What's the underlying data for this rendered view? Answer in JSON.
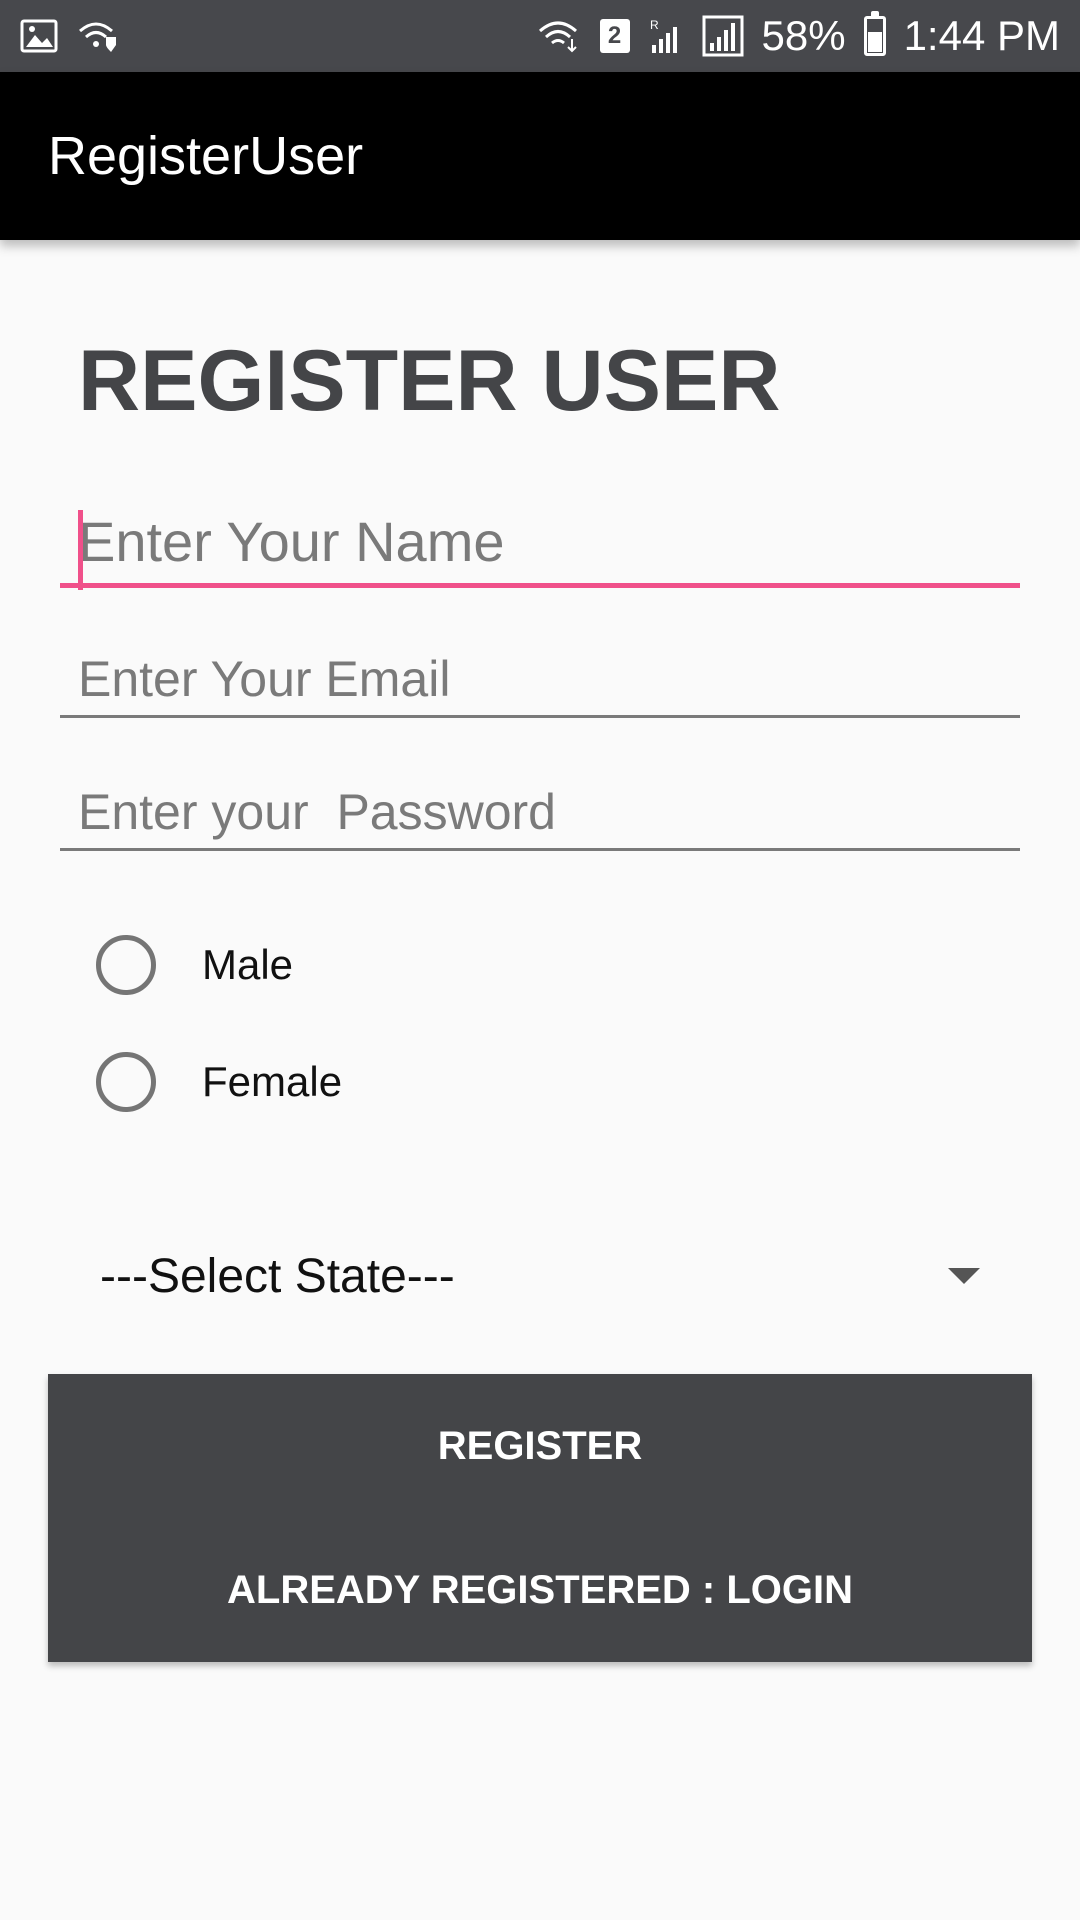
{
  "status_bar": {
    "battery": "58%",
    "time": "1:44 PM",
    "sim": "2",
    "icons": [
      "image-icon",
      "wifi-shield-icon",
      "wifi-icon",
      "sim-badge-icon",
      "signal-roaming-icon",
      "signal-icon",
      "battery-icon"
    ]
  },
  "app_bar": {
    "title": "RegisterUser"
  },
  "page": {
    "heading": "REGISTER USER"
  },
  "form": {
    "name": {
      "placeholder": "Enter Your Name",
      "value": ""
    },
    "email": {
      "placeholder": "Enter Your Email",
      "value": ""
    },
    "password": {
      "placeholder": "Enter your  Password",
      "value": ""
    },
    "gender_options": [
      "Male",
      "Female"
    ],
    "state": {
      "selected": "---Select State---"
    }
  },
  "buttons": {
    "register": "REGISTER",
    "login": "ALREADY REGISTERED : LOGIN"
  },
  "colors": {
    "accent": "#f0508a",
    "status_bar": "#47484c",
    "app_bar": "#000000",
    "button_panel": "#444548"
  }
}
